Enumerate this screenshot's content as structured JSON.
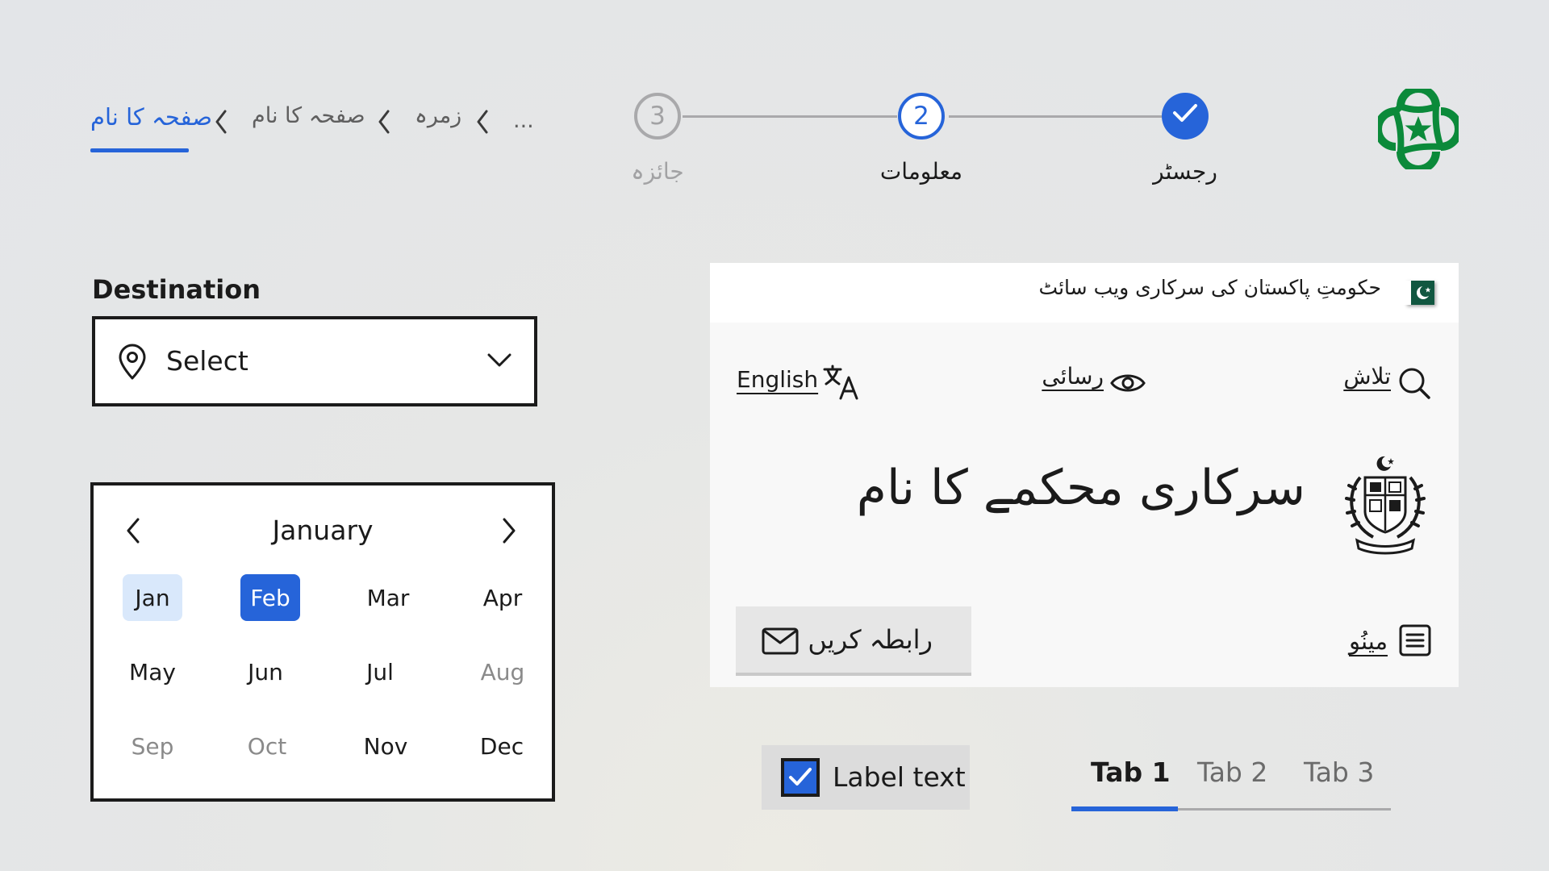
{
  "breadcrumb": {
    "items": [
      "...",
      "زمرہ",
      "صفحہ کا نام"
    ],
    "current": "صفحہ کا نام"
  },
  "stepper": {
    "steps": [
      {
        "label": "رجسٹر",
        "state": "complete"
      },
      {
        "label": "معلومات",
        "number": "2",
        "state": "current"
      },
      {
        "label": "جائزہ",
        "number": "3",
        "state": "upcoming"
      }
    ]
  },
  "logo": {
    "icon": "star-quatrefoil-logo",
    "color": "#0b8a3a"
  },
  "destination": {
    "label": "Destination",
    "value": "Select",
    "icons": [
      "location-pin-icon",
      "chevron-down-icon"
    ]
  },
  "month_picker": {
    "title": "January",
    "months": [
      {
        "label": "Jan",
        "state": "today"
      },
      {
        "label": "Feb",
        "state": "selected"
      },
      {
        "label": "Mar",
        "state": "normal"
      },
      {
        "label": "Apr",
        "state": "normal"
      },
      {
        "label": "May",
        "state": "normal"
      },
      {
        "label": "Jun",
        "state": "normal"
      },
      {
        "label": "Jul",
        "state": "normal"
      },
      {
        "label": "Aug",
        "state": "disabled"
      },
      {
        "label": "Sep",
        "state": "disabled"
      },
      {
        "label": "Oct",
        "state": "disabled"
      },
      {
        "label": "Nov",
        "state": "normal"
      },
      {
        "label": "Dec",
        "state": "normal"
      }
    ]
  },
  "gov_header": {
    "banner_text": "حکومتِ پاکستان کی سرکاری ویب سائٹ",
    "search_label": "تلاش",
    "accessibility_label": "رسائی",
    "language_label": "English",
    "agency_name": "سرکاری محکمے کا نام",
    "contact_label": "رابطہ کریں",
    "menu_label": "مینُو"
  },
  "checkbox": {
    "label": "Label text",
    "checked": true
  },
  "tabs": {
    "items": [
      "Tab 1",
      "Tab 2",
      "Tab 3"
    ],
    "active": "Tab 1"
  },
  "colors": {
    "primary": "#2664d9",
    "text": "#1b1b1b",
    "muted": "#8a8a8a",
    "flag_green": "#115740",
    "logo_green": "#0b8a3a"
  }
}
